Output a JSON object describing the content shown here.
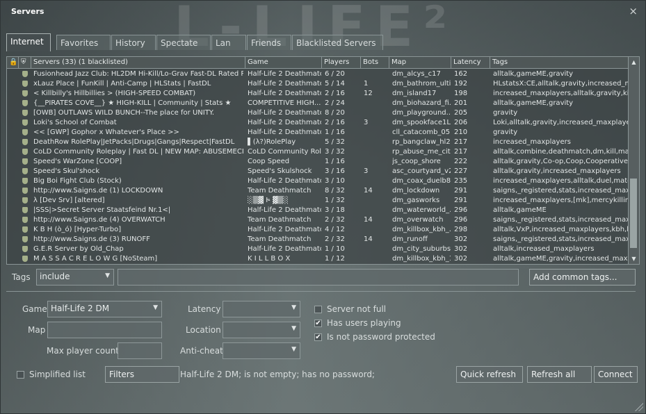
{
  "window": {
    "title": "Servers",
    "close_glyph": "×"
  },
  "tabs": [
    "Internet",
    "Favorites",
    "History",
    "Spectate",
    "Lan",
    "Friends",
    "Blacklisted Servers"
  ],
  "columns": {
    "lock": "",
    "secure": "",
    "servers": "Servers (33) (1 blacklisted)",
    "game": "Game",
    "players": "Players",
    "bots": "Bots",
    "map": "Map",
    "latency": "Latency",
    "tags": "Tags"
  },
  "servers": [
    {
      "name": "Fusionhead Jazz Club: HL2DM Hi-Kill/Lo-Grav Fast-DL Rated PG13",
      "game": "Half-Life 2 Deathmatch",
      "players": "6 / 20",
      "bots": "",
      "map": "dm_alcys_c17",
      "latency": "162",
      "tags": "alltalk,gameME,gravity"
    },
    {
      "name": "xLauz Place | FunKill | Anti-Camp | HLStats | FastDL",
      "game": "Half-Life 2 Deathmatch",
      "players": "5 / 14",
      "bots": "1",
      "map": "dm_bathrom_ulti...",
      "latency": "192",
      "tags": "HLstatsX:CE,alltalk,gravity,increased_max..."
    },
    {
      "name": "< Killbilly's Hillbillies > (HIGH-SPEED COMBAT)",
      "game": "Half-Life 2 Deathmatch",
      "players": "2 / 16",
      "bots": "12",
      "map": "dm_island17",
      "latency": "198",
      "tags": "increased_maxplayers,alltalk,gravity,killbill..."
    },
    {
      "name": "{__PIRATES COVE__}  ★ HIGH-KILL | Community | Stats ★",
      "game": "COMPETITIVE HIGH...",
      "players": "2 / 24",
      "bots": "",
      "map": "dm_biohazard_fi...",
      "latency": "201",
      "tags": "alltalk,gameME,gravity"
    },
    {
      "name": "[OWB] OUTLAWS WILD BUNCH--The place for UNITY.",
      "game": "Half-Life 2 Deathmatch",
      "players": "8 / 20",
      "bots": "",
      "map": "dm_playground...",
      "latency": "205",
      "tags": "gravity"
    },
    {
      "name": "Loki's School of Combat",
      "game": "Half-Life 2 Deathmatch",
      "players": "2 / 16",
      "bots": "3",
      "map": "dm_spookface1L...",
      "latency": "206",
      "tags": "Loki,alltalk,gravity,increased_maxplayers"
    },
    {
      "name": "<< [GWP] Gophor x Whatever's Place >>",
      "game": "Half-Life 2 Deathmatch",
      "players": "1 / 16",
      "bots": "",
      "map": "cll_catacomb_05",
      "latency": "210",
      "tags": "gravity"
    },
    {
      "name": "DeathRow RolePlay|JetPacks|Drugs|Gangs|Respect|FastDL",
      "game": "▌(λ?)RolePlay",
      "players": "5 / 32",
      "bots": "",
      "map": "rp_bangclaw_hl2...",
      "latency": "217",
      "tags": "increased_maxplayers"
    },
    {
      "name": "CoLD Community Roleplay | Fast DL | NEW MAP: ABUSEMECITY",
      "game": "CoLD Community Rol...",
      "players": "3 / 32",
      "bots": "",
      "map": "rp_abuse_me_cit...",
      "latency": "217",
      "tags": "alltalk,combine,deathmatch,dm,kill,maxpla..."
    },
    {
      "name": "Speed's WarZone [COOP]",
      "game": "Coop Speed",
      "players": "1 / 16",
      "bots": "",
      "map": "js_coop_shore",
      "latency": "222",
      "tags": "alltalk,gravity,Co-op,Coop,Cooperative,S..."
    },
    {
      "name": "Speed's Skul'shock",
      "game": "Speed's Skulshock",
      "players": "3 / 16",
      "bots": "3",
      "map": "asc_courtyard_v2",
      "latency": "227",
      "tags": "alltalk,gravity,increased_maxplayers"
    },
    {
      "name": "Big Boi Fight Club (Stock)",
      "game": "Half-Life 2 Deathmatch",
      "players": "3 / 10",
      "bots": "",
      "map": "dm_coax_duelb89",
      "latency": "235",
      "tags": "increased_maxplayers,alltalk,duel,match"
    },
    {
      "name": "http://www.Saigns.de (1) LOCKDOWN",
      "game": "Team Deathmatch",
      "players": "8 / 32",
      "bots": "14",
      "map": "dm_lockdown",
      "latency": "291",
      "tags": "saigns,_registered,stats,increased_maxpla..."
    },
    {
      "name": "λ [Dev Srv] [altered]",
      "game": "░▒▓ Ͱ̵ ▓▒░",
      "players": "1 / 32",
      "bots": "",
      "map": "dm_gasworks",
      "latency": "291",
      "tags": "increased_maxplayers,[mk],mercykilling,..."
    },
    {
      "name": "|SSS|>Secret Server Staatsfeind Nr.1<|",
      "game": "Half-Life 2 Deathmatch",
      "players": "3 / 18",
      "bots": "",
      "map": "dm_waterworld_...",
      "latency": "296",
      "tags": "alltalk,gameME"
    },
    {
      "name": "http://www.Saigns.de (4) OVERWATCH",
      "game": "Team Deathmatch",
      "players": "2 / 32",
      "bots": "14",
      "map": "dm_overwatch",
      "latency": "296",
      "tags": "saigns,_registered,stats,increased_maxpla..."
    },
    {
      "name": "K    B    H  (ò_ó) [Hyper-Turbo]",
      "game": "Half-Life 2 Deathmatch",
      "players": "4 / 12",
      "bots": "",
      "map": "dm_killbox_kbh_...",
      "latency": "298",
      "tags": "alltalk,VxP,increased_maxplayers,kbh,killb..."
    },
    {
      "name": "http://www.Saigns.de (3) RUNOFF",
      "game": "Team Deathmatch",
      "players": "2 / 32",
      "bots": "14",
      "map": "dm_runoff",
      "latency": "302",
      "tags": "saigns,_registered,stats,increased_maxpla..."
    },
    {
      "name": "G.E.R Server by Old_Chap",
      "game": "Half-Life 2 Deathmatch",
      "players": "1 / 10",
      "bots": "",
      "map": "dm_city_suburbs...",
      "latency": "302",
      "tags": "alltalk,increased_maxplayers"
    },
    {
      "name": "M  A  S  S  A  C  R  E     L O W  G     [NoSteam]",
      "game": "K  I  L  L  B  O  X",
      "players": "1 / 12",
      "bots": "",
      "map": "dm_killbox_kbh_1",
      "latency": "302",
      "tags": "alltalk,gameME,gravity,increased_maxpla..."
    }
  ],
  "filters": {
    "tags_label": "Tags",
    "tags_mode": "include",
    "tags_value": "",
    "add_common_tags": "Add common tags...",
    "game_label": "Game",
    "game_value": "Half-Life 2 DM",
    "map_label": "Map",
    "map_value": "",
    "max_player_label": "Max player count",
    "max_player_value": "",
    "latency_label": "Latency",
    "latency_value": "",
    "location_label": "Location",
    "location_value": "",
    "anticheat_label": "Anti-cheat",
    "anticheat_value": "",
    "server_not_full": "Server not full",
    "server_not_full_checked": false,
    "has_users": "Has users playing",
    "has_users_checked": true,
    "no_password": "Is not password protected",
    "no_password_checked": true
  },
  "footer": {
    "simplified_list": "Simplified list",
    "simplified_checked": false,
    "filters_button": "Filters",
    "filter_summary": "Half-Life 2 DM; is not empty; has no password;",
    "quick_refresh": "Quick refresh",
    "refresh_all": "Refresh all",
    "connect": "Connect"
  },
  "colors": {
    "background": "#5f6a6b",
    "border": "#8a9596",
    "text": "#e6e6e6"
  },
  "icons": {
    "secure": "shield-icon",
    "lock": "lock-icon",
    "close": "close-icon"
  }
}
